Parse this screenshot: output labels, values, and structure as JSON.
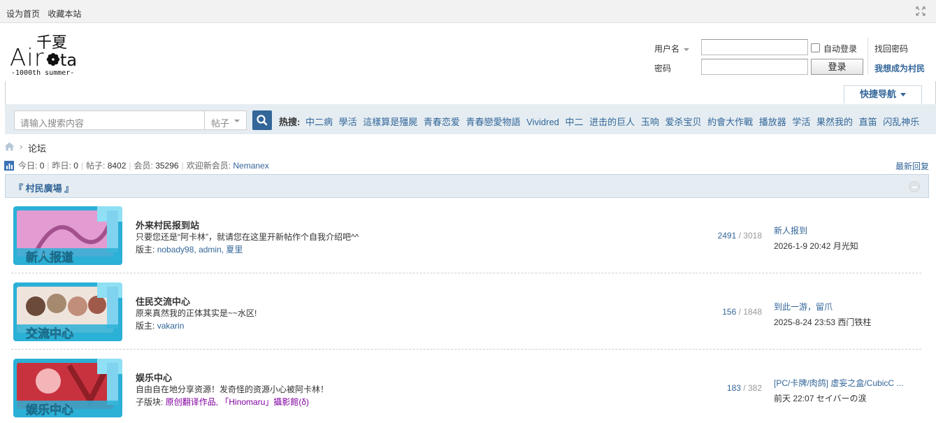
{
  "topbar": {
    "set_home": "设为首页",
    "bookmark": "收藏本站"
  },
  "logo": {
    "chinese": "千夏",
    "name": "Airota",
    "tagline": "-1000th summer-"
  },
  "login": {
    "username_label": "用户名",
    "password_label": "密码",
    "auto_login_label": "自动登录",
    "login_button": "登录",
    "forgot_password": "找回密码",
    "register": "我想成为村民"
  },
  "quick_nav": "快捷导航",
  "search": {
    "placeholder": "请输入搜索内容",
    "type": "帖子",
    "hot_label": "热搜:",
    "hot_terms": [
      "中二病",
      "學活",
      "這樣算是殭屍",
      "青春恋爱",
      "青春戀愛物語",
      "Vividred",
      "中二",
      "进击的巨人",
      "玉响",
      "爱杀宝贝",
      "約會大作戰",
      "播放器",
      "学活",
      "果然我的",
      "直笛",
      "闪乱神乐"
    ]
  },
  "breadcrumb": {
    "current": "论坛"
  },
  "stats": {
    "today_label": "今日:",
    "today": "0",
    "yesterday_label": "昨日:",
    "yesterday": "0",
    "posts_label": "帖子:",
    "posts": "8402",
    "members_label": "会员:",
    "members": "35296",
    "welcome_label": "欢迎新会员:",
    "newest_member": "Nemanex",
    "latest_replies": "最新回复"
  },
  "category": {
    "title": "『 村民廣場 』"
  },
  "forums": [
    {
      "name": "外来村民报到站",
      "description": "只要您还是“阿卡林”，就请您在这里开新帖作个自我介绍吧^^",
      "mods_label": "版主:",
      "mods": "nobady98, admin, 夏里",
      "threads": "2491",
      "posts": "3018",
      "last_title": "新人报到",
      "last_meta": "2026-1-9 20:42 月光知",
      "icon_text": "新人报道",
      "icon_color": "#c04a9a"
    },
    {
      "name": "住民交流中心",
      "description": "原来真然我的正体其实是~~水区!",
      "mods_label": "版主:",
      "mods": "vakarin",
      "threads": "156",
      "posts": "1848",
      "last_title": "到此一游，留爪",
      "last_meta": "2025-8-24 23:53 西门铁柱",
      "icon_text": "交流中心",
      "icon_color": "#7a5a4a"
    },
    {
      "name": "娱乐中心",
      "description": "自由自在地分享资源！发奇怪的资源小心被阿卡林！",
      "mods_label": "子版块:",
      "subforums": "原创翻译作品, 「Hinomaru」攝影館(δ)",
      "threads": "183",
      "posts": "382",
      "last_title": "[PC/卡牌/肉鸽] 虚妄之盒/CubicC ...",
      "last_meta": "前天 22:07 セイバーの涙",
      "icon_text": "娱乐中心",
      "icon_color": "#c03040"
    }
  ]
}
